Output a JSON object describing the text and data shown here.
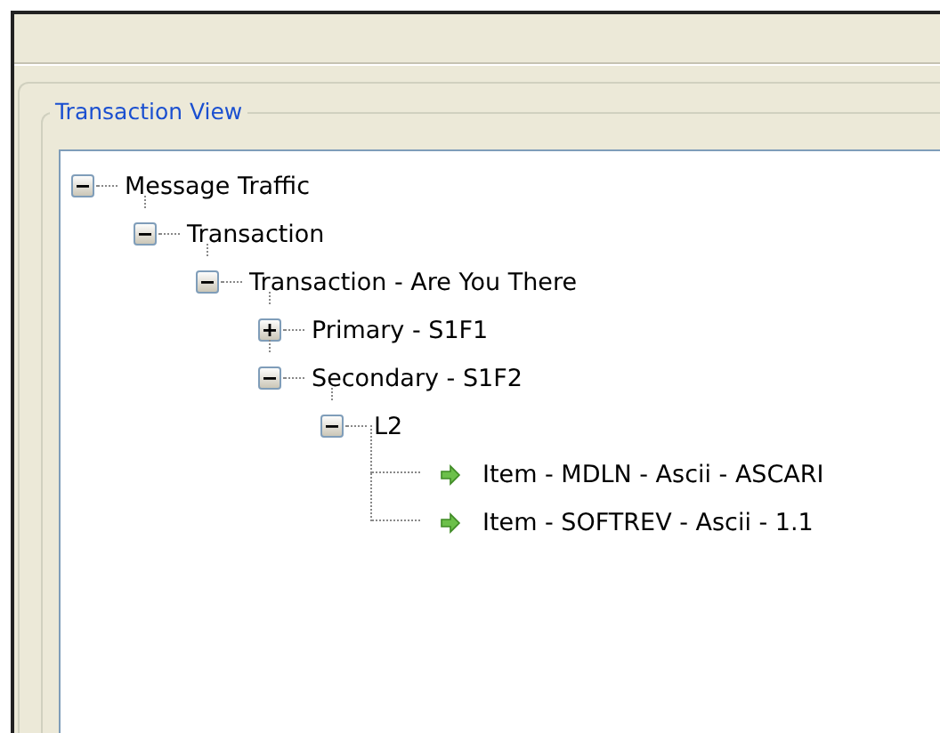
{
  "group": {
    "title": "Transaction View",
    "tree": [
      {
        "kind": "branch",
        "label": "Message Traffic",
        "expanded": true,
        "children": [
          {
            "kind": "branch",
            "label": "Transaction",
            "expanded": true,
            "children": [
              {
                "kind": "branch",
                "label": "Transaction - Are You There",
                "expanded": true,
                "children": [
                  {
                    "kind": "branch",
                    "label": "Primary - S1F1",
                    "expanded": false
                  },
                  {
                    "kind": "branch",
                    "label": "Secondary - S1F2",
                    "expanded": true,
                    "children": [
                      {
                        "kind": "branch",
                        "label": "L2",
                        "expanded": true,
                        "children": [
                          {
                            "kind": "leaf",
                            "label": "Item - MDLN - Ascii - ASCARI"
                          },
                          {
                            "kind": "leaf",
                            "label": "Item - SOFTREV - Ascii - 1.1"
                          }
                        ]
                      }
                    ]
                  }
                ]
              }
            ]
          }
        ]
      }
    ]
  }
}
